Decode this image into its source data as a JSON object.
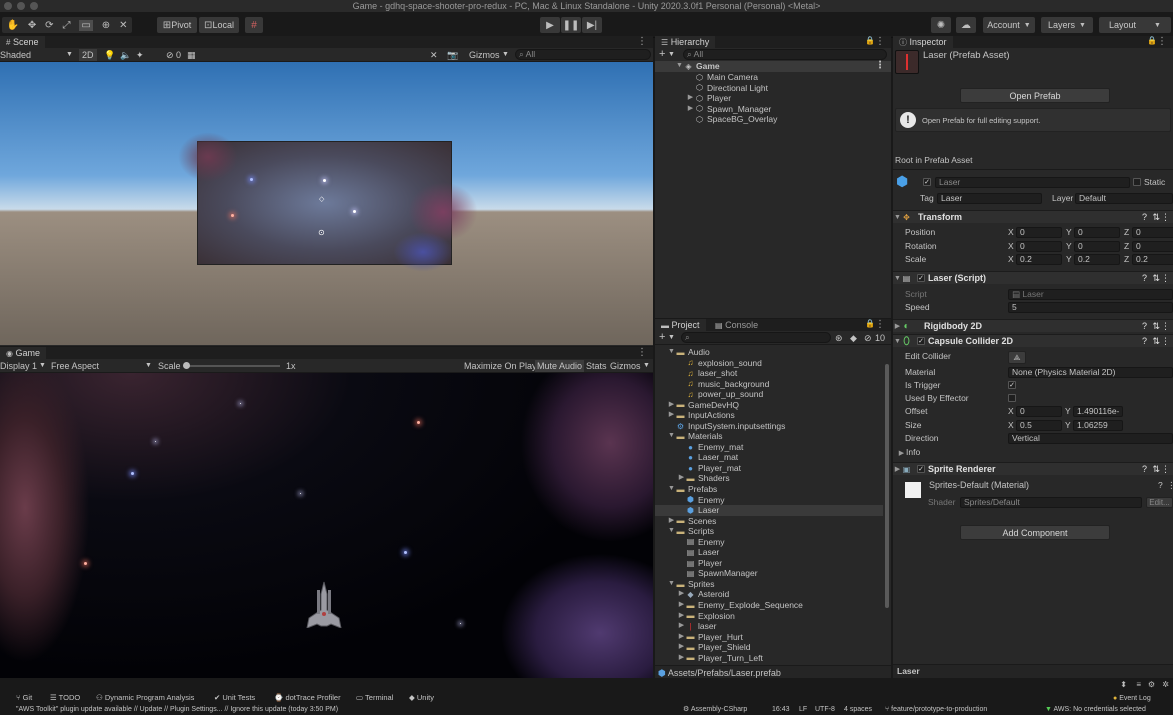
{
  "window": {
    "title": "Game - gdhq-space-shooter-pro-redux - PC, Mac & Linux Standalone - Unity 2020.3.0f1 Personal (Personal) <Metal>"
  },
  "toolbar": {
    "pivot": "Pivot",
    "local": "Local",
    "account": "Account",
    "layers": "Layers",
    "layout": "Layout"
  },
  "scene": {
    "tab": "Scene",
    "shading": "Shaded",
    "mode_2d": "2D",
    "hidden_count": "0",
    "gizmos": "Gizmos",
    "search_placeholder": "All"
  },
  "game": {
    "tab": "Game",
    "display": "Display 1",
    "aspect": "Free Aspect",
    "scale_label": "Scale",
    "scale_value": "1x",
    "maximize": "Maximize On Play",
    "mute": "Mute Audio",
    "stats": "Stats",
    "gizmos": "Gizmos"
  },
  "hierarchy": {
    "tab": "Hierarchy",
    "search_placeholder": "All",
    "root": "Game",
    "items": [
      "Main Camera",
      "Directional Light",
      "Player",
      "Spawn_Manager",
      "SpaceBG_Overlay"
    ]
  },
  "project": {
    "tab": "Project",
    "console_tab": "Console",
    "hidden_count": "10",
    "tree": [
      {
        "label": "Audio",
        "kind": "folder",
        "depth": 0,
        "arrow": "▼"
      },
      {
        "label": "explosion_sound",
        "kind": "audio",
        "depth": 1,
        "arrow": ""
      },
      {
        "label": "laser_shot",
        "kind": "audio",
        "depth": 1,
        "arrow": ""
      },
      {
        "label": "music_background",
        "kind": "audio",
        "depth": 1,
        "arrow": ""
      },
      {
        "label": "power_up_sound",
        "kind": "audio",
        "depth": 1,
        "arrow": ""
      },
      {
        "label": "GameDevHQ",
        "kind": "folder",
        "depth": 0,
        "arrow": "▶"
      },
      {
        "label": "InputActions",
        "kind": "folder",
        "depth": 0,
        "arrow": "▶"
      },
      {
        "label": "InputSystem.inputsettings",
        "kind": "settings",
        "depth": 0,
        "arrow": ""
      },
      {
        "label": "Materials",
        "kind": "folder",
        "depth": 0,
        "arrow": "▼"
      },
      {
        "label": "Enemy_mat",
        "kind": "mat",
        "depth": 1,
        "arrow": ""
      },
      {
        "label": "Laser_mat",
        "kind": "mat",
        "depth": 1,
        "arrow": ""
      },
      {
        "label": "Player_mat",
        "kind": "mat",
        "depth": 1,
        "arrow": ""
      },
      {
        "label": "Shaders",
        "kind": "folder",
        "depth": 1,
        "arrow": "▶"
      },
      {
        "label": "Prefabs",
        "kind": "folder",
        "depth": 0,
        "arrow": "▼"
      },
      {
        "label": "Enemy",
        "kind": "cube",
        "depth": 1,
        "arrow": ""
      },
      {
        "label": "Laser",
        "kind": "cube",
        "depth": 1,
        "arrow": "",
        "selected": true
      },
      {
        "label": "Scenes",
        "kind": "folder",
        "depth": 0,
        "arrow": "▶"
      },
      {
        "label": "Scripts",
        "kind": "folder",
        "depth": 0,
        "arrow": "▼"
      },
      {
        "label": "Enemy",
        "kind": "script",
        "depth": 1,
        "arrow": ""
      },
      {
        "label": "Laser",
        "kind": "script",
        "depth": 1,
        "arrow": ""
      },
      {
        "label": "Player",
        "kind": "script",
        "depth": 1,
        "arrow": ""
      },
      {
        "label": "SpawnManager",
        "kind": "script",
        "depth": 1,
        "arrow": ""
      },
      {
        "label": "Sprites",
        "kind": "folder",
        "depth": 0,
        "arrow": "▼"
      },
      {
        "label": "Asteroid",
        "kind": "sprite",
        "depth": 1,
        "arrow": "▶"
      },
      {
        "label": "Enemy_Explode_Sequence",
        "kind": "folder",
        "depth": 1,
        "arrow": "▶"
      },
      {
        "label": "Explosion",
        "kind": "folder",
        "depth": 1,
        "arrow": "▶"
      },
      {
        "label": "laser",
        "kind": "laser",
        "depth": 1,
        "arrow": "▶"
      },
      {
        "label": "Player_Hurt",
        "kind": "folder",
        "depth": 1,
        "arrow": "▶"
      },
      {
        "label": "Player_Shield",
        "kind": "folder",
        "depth": 1,
        "arrow": "▶"
      },
      {
        "label": "Player_Turn_Left",
        "kind": "folder",
        "depth": 1,
        "arrow": "▶"
      }
    ],
    "path": "Assets/Prefabs/Laser.prefab"
  },
  "inspector": {
    "tab": "Inspector",
    "asset_title": "Laser (Prefab Asset)",
    "open_prefab": "Open Prefab",
    "info_text": "Open Prefab for full editing support.",
    "root_label": "Root in Prefab Asset",
    "object_name": "Laser",
    "static_label": "Static",
    "tag_label": "Tag",
    "tag_value": "Laser",
    "layer_label": "Layer",
    "layer_value": "Default",
    "transform": {
      "title": "Transform",
      "position_label": "Position",
      "position": [
        "0",
        "0",
        "0"
      ],
      "rotation_label": "Rotation",
      "rotation": [
        "0",
        "0",
        "0"
      ],
      "scale_label": "Scale",
      "scale": [
        "0.2",
        "0.2",
        "0.2"
      ]
    },
    "laser_script": {
      "title": "Laser (Script)",
      "script_label": "Script",
      "script_value": "Laser",
      "speed_label": "Speed",
      "speed_value": "5"
    },
    "rigidbody": {
      "title": "Rigidbody 2D"
    },
    "capsule": {
      "title": "Capsule Collider 2D",
      "edit_collider": "Edit Collider",
      "material_label": "Material",
      "material_value": "None (Physics Material 2D)",
      "trigger_label": "Is Trigger",
      "effector_label": "Used By Effector",
      "offset_label": "Offset",
      "offset": [
        "0",
        "1.490116e-"
      ],
      "size_label": "Size",
      "size": [
        "0.5",
        "1.06259"
      ],
      "direction_label": "Direction",
      "direction_value": "Vertical",
      "info_label": "Info"
    },
    "sprite_renderer": {
      "title": "Sprite Renderer"
    },
    "material": {
      "name": "Sprites-Default (Material)",
      "shader_label": "Shader",
      "shader_value": "Sprites/Default",
      "edit": "Edit..."
    },
    "add_component": "Add Component",
    "preview_label": "Laser"
  },
  "bottom_tabs": [
    "Git",
    "TODO",
    "Dynamic Program Analysis",
    "Unit Tests",
    "dotTrace Profiler",
    "Terminal",
    "Unity"
  ],
  "status": {
    "message": "\"AWS Toolkit\" plugin update available // Update // Plugin Settings... // Ignore this update (today 3:50 PM)",
    "assembly": "Assembly-CSharp",
    "time": "16:43",
    "line_ending": "LF",
    "encoding": "UTF-8",
    "indent": "4 spaces",
    "branch": "feature/prototype-to-production",
    "aws": "AWS: No credentials selected",
    "event_log": "Event Log"
  }
}
